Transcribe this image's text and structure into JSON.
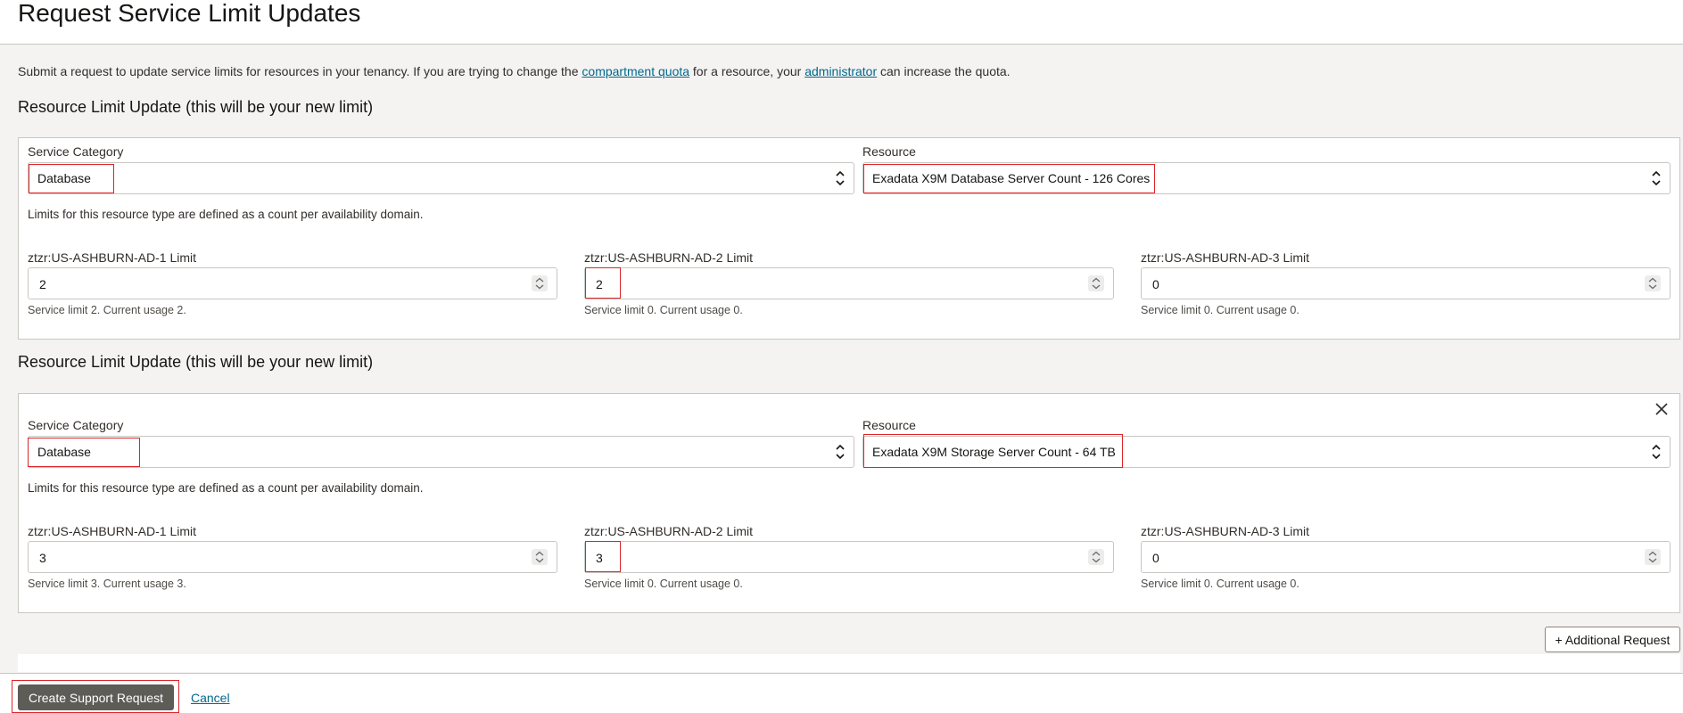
{
  "header": {
    "title": "Request Service Limit Updates"
  },
  "intro": {
    "text_before": "Submit a request to update service limits for resources in your tenancy. If you are trying to change the ",
    "link1": "compartment quota",
    "text_middle": " for a resource, your ",
    "link2": "administrator",
    "text_after": " can increase the quota."
  },
  "requests": [
    {
      "heading": "Resource Limit Update (this will be your new limit)",
      "service_category_label": "Service Category",
      "service_category_value": "Database",
      "resource_label": "Resource",
      "resource_value": "Exadata X9M Database Server Count - 126 Cores",
      "scope_note": "Limits for this resource type are defined as a count per availability domain.",
      "ads": [
        {
          "label": "ztzr:US-ASHBURN-AD-1 Limit",
          "value": "2",
          "help": "Service limit 2. Current usage 2."
        },
        {
          "label": "ztzr:US-ASHBURN-AD-2 Limit",
          "value": "2",
          "help": "Service limit 0. Current usage 0."
        },
        {
          "label": "ztzr:US-ASHBURN-AD-3 Limit",
          "value": "0",
          "help": "Service limit 0. Current usage 0."
        }
      ]
    },
    {
      "heading": "Resource Limit Update (this will be your new limit)",
      "service_category_label": "Service Category",
      "service_category_value": "Database",
      "resource_label": "Resource",
      "resource_value": "Exadata X9M Storage Server Count - 64 TB",
      "scope_note": "Limits for this resource type are defined as a count per availability domain.",
      "ads": [
        {
          "label": "ztzr:US-ASHBURN-AD-1 Limit",
          "value": "3",
          "help": "Service limit 3. Current usage 3."
        },
        {
          "label": "ztzr:US-ASHBURN-AD-2 Limit",
          "value": "3",
          "help": "Service limit 0. Current usage 0."
        },
        {
          "label": "ztzr:US-ASHBURN-AD-3 Limit",
          "value": "0",
          "help": "Service limit 0. Current usage 0."
        }
      ]
    }
  ],
  "actions": {
    "additional_request": "+ Additional Request",
    "create": "Create Support Request",
    "cancel": "Cancel"
  },
  "colors": {
    "highlight": "#d9262a",
    "link": "#00688c",
    "primary_button": "#5e5c57",
    "page_background": "#f4f3f2"
  },
  "icons": {
    "select": "chevron-updown-icon",
    "number": "spinner-icon",
    "remove": "close-icon"
  }
}
